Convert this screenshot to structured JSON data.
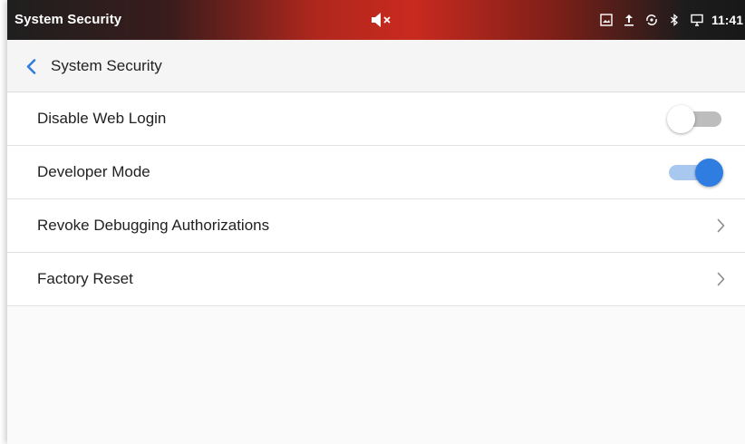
{
  "status_bar": {
    "title": "System Security",
    "time": "11:41",
    "icons": [
      "mute-icon",
      "screenshot-icon",
      "upload-icon",
      "sync-icon",
      "bluetooth-icon",
      "cast-icon"
    ]
  },
  "header": {
    "back_icon": "chevron-left-icon",
    "title": "System Security"
  },
  "settings": [
    {
      "label": "Disable Web Login",
      "control": "toggle",
      "on": false
    },
    {
      "label": "Developer Mode",
      "control": "toggle",
      "on": true
    },
    {
      "label": "Revoke Debugging Authorizations",
      "control": "chevron"
    },
    {
      "label": "Factory Reset",
      "control": "chevron"
    }
  ],
  "colors": {
    "accent": "#2f7de1",
    "accent_track": "#a9c8f0",
    "toggle_off_track": "#bdbdbd",
    "toggle_off_thumb": "#ffffff",
    "status_bar_red": "#c92a1f",
    "back_arrow": "#2f7de1"
  }
}
